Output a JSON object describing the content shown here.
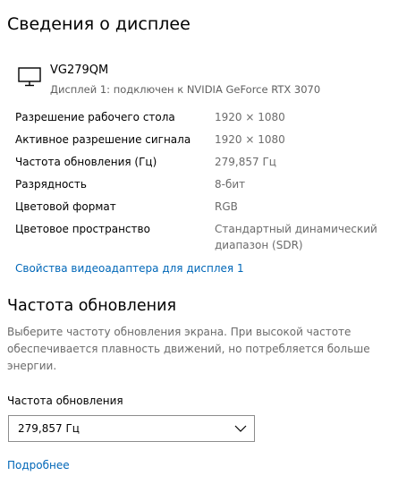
{
  "header": {
    "title": "Сведения о дисплее"
  },
  "monitor": {
    "icon": "monitor-icon",
    "name": "VG279QM",
    "subtitle": "Дисплей 1: подключен к NVIDIA GeForce RTX 3070"
  },
  "info": {
    "rows": [
      {
        "label": "Разрешение рабочего стола",
        "value": "1920 × 1080"
      },
      {
        "label": "Активное разрешение сигнала",
        "value": "1920 × 1080"
      },
      {
        "label": "Частота обновления (Гц)",
        "value": "279,857 Гц"
      },
      {
        "label": "Разрядность",
        "value": "8-бит"
      },
      {
        "label": "Цветовой формат",
        "value": "RGB"
      },
      {
        "label": "Цветовое пространство",
        "value_line1": "Стандартный динамический",
        "value_line2": "диапазон (SDR)"
      }
    ],
    "adapter_link": "Свойства видеоадаптера для дисплея 1"
  },
  "refresh": {
    "title": "Частота обновления",
    "description_lines": [
      "Выберите частоту обновления экрана. При высокой частоте",
      "обеспечивается плавность движений, но потребляется больше",
      "энергии."
    ],
    "field_label": "Частота обновления",
    "selected_value": "279,857 Гц",
    "more_link": "Подробнее"
  },
  "colors": {
    "link": "#0067b8",
    "secondary_text": "#6b6b6b",
    "border": "#8c8c8c"
  }
}
